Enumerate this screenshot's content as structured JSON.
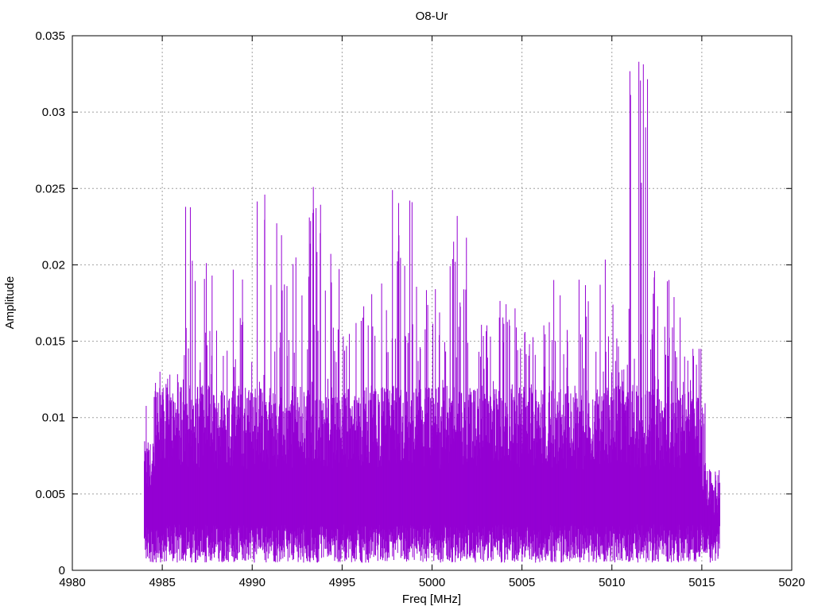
{
  "chart_data": {
    "type": "line",
    "style": "impulses",
    "title": "O8-Ur",
    "xlabel": "Freq [MHz]",
    "ylabel": "Amplitude",
    "xlim": [
      4980,
      5020
    ],
    "ylim": [
      0,
      0.035
    ],
    "xticks": [
      "4980",
      "4985",
      "4990",
      "4995",
      "5000",
      "5005",
      "5010",
      "5015",
      "5020"
    ],
    "yticks": [
      "0",
      "0.005",
      "0.01",
      "0.015",
      "0.02",
      "0.025",
      "0.03",
      "0.035"
    ],
    "grid": true,
    "series_color": "#9400d3",
    "data_range_x": [
      4984.0,
      5016.0
    ],
    "envelope_bin_mhz": 1,
    "envelope_x": [
      4984,
      4985,
      4986,
      4987,
      4988,
      4989,
      4990,
      4991,
      4992,
      4993,
      4994,
      4995,
      4996,
      4997,
      4998,
      4999,
      5000,
      5001,
      5002,
      5003,
      5004,
      5005,
      5006,
      5007,
      5008,
      5009,
      5010,
      5011,
      5012,
      5013,
      5014,
      5015
    ],
    "envelope_max": [
      0.013,
      0.0135,
      0.024,
      0.0205,
      0.0205,
      0.021,
      0.0245,
      0.0235,
      0.0215,
      0.025,
      0.021,
      0.019,
      0.0185,
      0.019,
      0.025,
      0.019,
      0.0205,
      0.023,
      0.0165,
      0.0185,
      0.018,
      0.0185,
      0.0205,
      0.02,
      0.02,
      0.021,
      0.0195,
      0.0335,
      0.0205,
      0.0195,
      0.0145,
      0.0065
    ],
    "typical_level": 0.011,
    "peaks": [
      {
        "x": 5011.5,
        "y": 0.0333
      },
      {
        "x": 4993.4,
        "y": 0.0251
      },
      {
        "x": 4997.8,
        "y": 0.0249
      },
      {
        "x": 4990.7,
        "y": 0.0246
      },
      {
        "x": 4986.3,
        "y": 0.0238
      },
      {
        "x": 5001.4,
        "y": 0.0232
      }
    ]
  }
}
